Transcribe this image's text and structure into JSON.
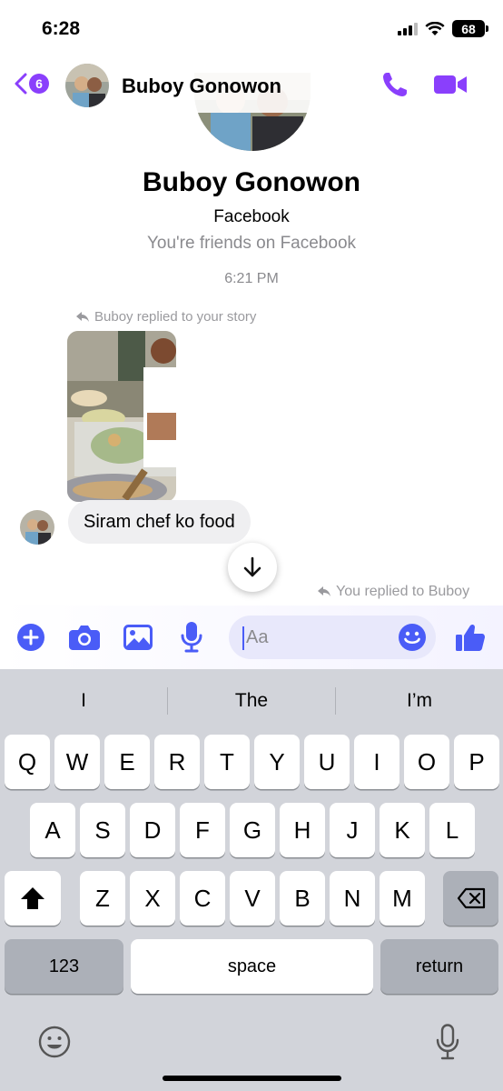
{
  "status": {
    "time": "6:28",
    "battery": "68"
  },
  "header": {
    "back_count": "6",
    "contact_name": "Buboy Gonowon"
  },
  "profile": {
    "name": "Buboy Gonowon",
    "platform": "Facebook",
    "relationship": "You're friends on Facebook"
  },
  "conversation": {
    "timestamp": "6:21 PM",
    "reply_note_incoming": "Buboy replied to your story",
    "message": "Siram chef ko food",
    "reply_note_outgoing": "You replied to Buboy"
  },
  "composer": {
    "placeholder": "Aa"
  },
  "keyboard": {
    "suggestions": [
      "I",
      "The",
      "I’m"
    ],
    "row1": [
      "Q",
      "W",
      "E",
      "R",
      "T",
      "Y",
      "U",
      "I",
      "O",
      "P"
    ],
    "row2": [
      "A",
      "S",
      "D",
      "F",
      "G",
      "H",
      "J",
      "K",
      "L"
    ],
    "row3": [
      "Z",
      "X",
      "C",
      "V",
      "B",
      "N",
      "M"
    ],
    "numbers_label": "123",
    "space_label": "space",
    "return_label": "return"
  },
  "colors": {
    "accent": "#8a3ffc",
    "composer_blue": "#4a5cf7",
    "bubble_bg": "#efeff1"
  }
}
